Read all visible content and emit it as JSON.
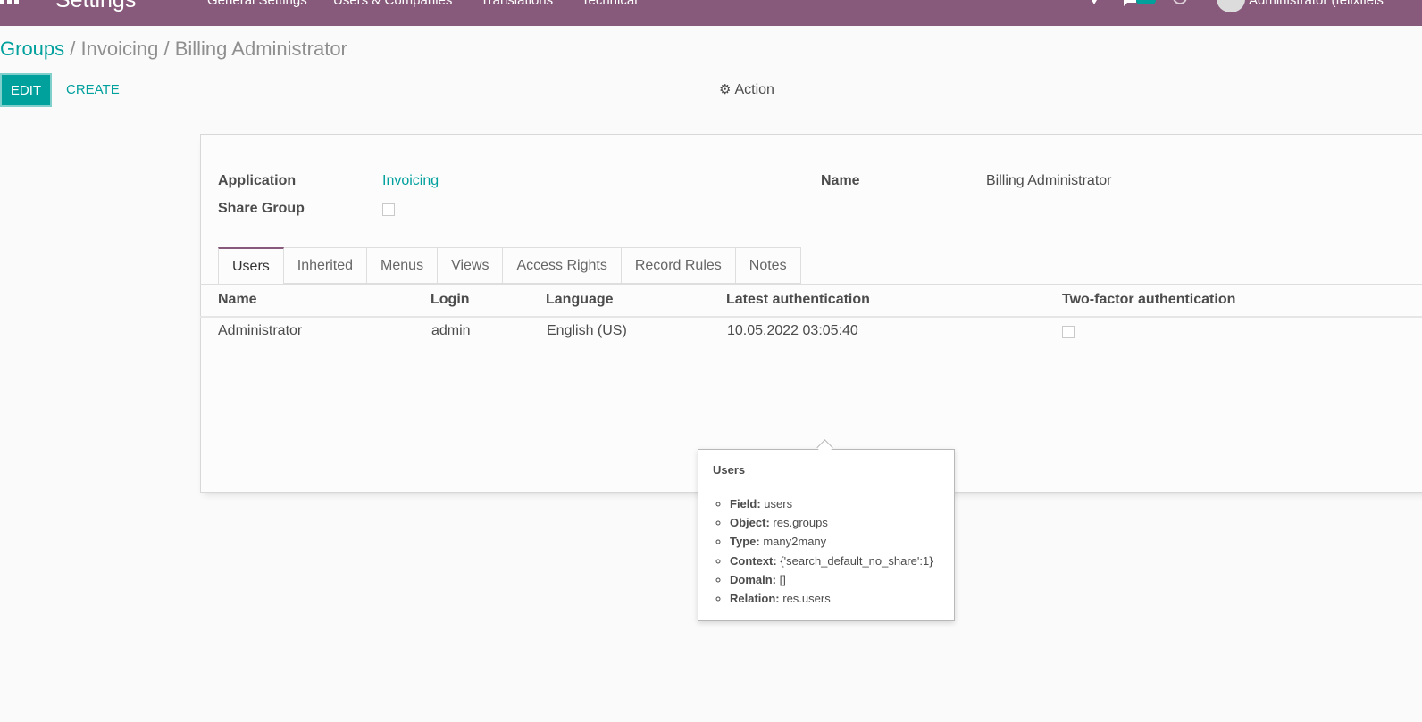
{
  "navbar": {
    "brand": "Settings",
    "menu": [
      "General Settings",
      "Users & Companies",
      "Translations",
      "Technical"
    ],
    "user": "Administrator (felixfiels"
  },
  "breadcrumb": {
    "root": "Groups",
    "separator": " / ",
    "middle": "Invoicing",
    "current": "Billing Administrator"
  },
  "buttons": {
    "edit": "EDIT",
    "create": "CREATE",
    "action": "Action"
  },
  "form": {
    "application_label": "Application",
    "application_value": "Invoicing",
    "share_group_label": "Share Group",
    "share_group_checked": false,
    "name_label": "Name",
    "name_value": "Billing Administrator"
  },
  "tabs": [
    "Users",
    "Inherited",
    "Menus",
    "Views",
    "Access Rights",
    "Record Rules",
    "Notes"
  ],
  "active_tab": "Users",
  "table": {
    "columns": [
      "Name",
      "Login",
      "Language",
      "Latest authentication",
      "Two-factor authentication"
    ],
    "rows": [
      {
        "name": "Administrator",
        "login": "admin",
        "language": "English (US)",
        "latest_auth": "10.05.2022 03:05:40",
        "two_factor": false
      }
    ]
  },
  "tooltip": {
    "title": "Users",
    "items": [
      {
        "key": "Field:",
        "value": "users"
      },
      {
        "key": "Object:",
        "value": "res.groups"
      },
      {
        "key": "Type:",
        "value": "many2many"
      },
      {
        "key": "Context:",
        "value": "{'search_default_no_share':1}"
      },
      {
        "key": "Domain:",
        "value": "[]"
      },
      {
        "key": "Relation:",
        "value": "res.users"
      }
    ]
  },
  "colors": {
    "navbar": "#875a7b",
    "accent": "#00a09d",
    "text": "#4c4c4c"
  },
  "icons": {
    "apps": "apps-grid-icon",
    "activity": "activity-icon",
    "messages": "messages-icon",
    "clock": "clock-icon",
    "avatar": "user-avatar",
    "action": "gear-icon"
  }
}
